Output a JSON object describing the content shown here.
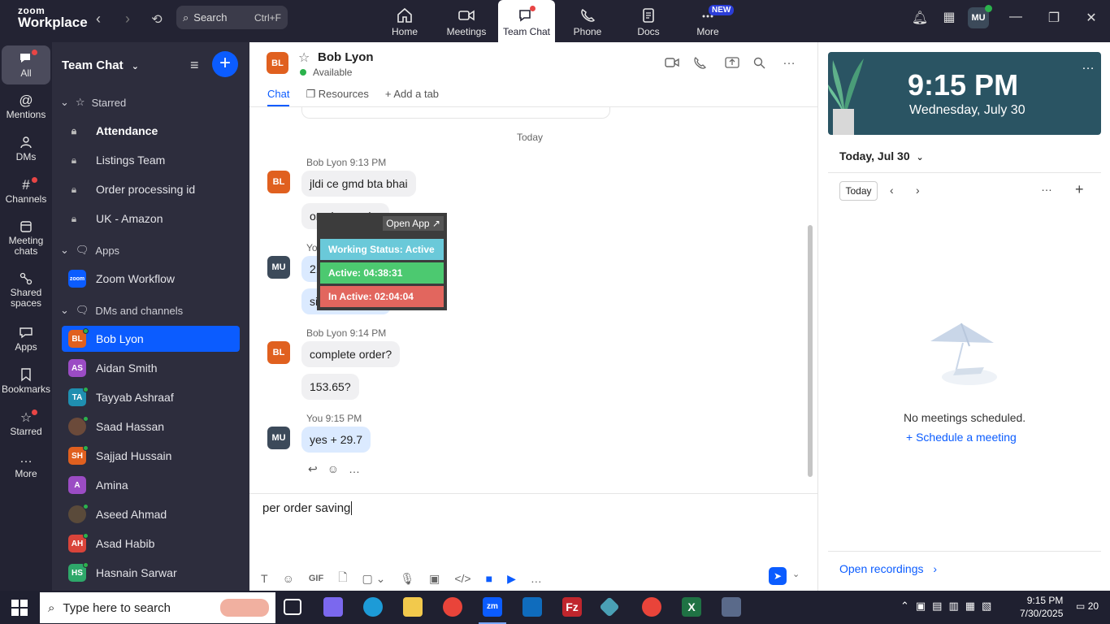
{
  "app": {
    "brand_top": "zoom",
    "brand_bottom": "Workplace"
  },
  "search": {
    "placeholder": "Search",
    "shortcut": "Ctrl+F"
  },
  "topnav": [
    {
      "label": "Home"
    },
    {
      "label": "Meetings"
    },
    {
      "label": "Team Chat"
    },
    {
      "label": "Phone"
    },
    {
      "label": "Docs"
    },
    {
      "label": "More"
    }
  ],
  "new_badge": "NEW",
  "user": {
    "initials": "MU"
  },
  "rail": [
    {
      "label": "All"
    },
    {
      "label": "Mentions"
    },
    {
      "label": "DMs"
    },
    {
      "label": "Channels"
    },
    {
      "label": "Meeting chats"
    },
    {
      "label": "Shared spaces"
    },
    {
      "label": "Apps"
    },
    {
      "label": "Bookmarks"
    },
    {
      "label": "Starred"
    },
    {
      "label": "More"
    }
  ],
  "sidebar": {
    "title": "Team Chat",
    "sections": {
      "starred": "Starred",
      "apps": "Apps",
      "dms": "DMs and channels"
    },
    "starred_items": [
      "Attendance",
      "Listings Team",
      "Order processing id",
      "UK - Amazon"
    ],
    "app_items": [
      "Zoom Workflow"
    ],
    "app_icon_text": "zoom",
    "contacts": [
      {
        "initials": "BL",
        "name": "Bob Lyon",
        "color": "#e0601f"
      },
      {
        "initials": "AS",
        "name": "Aidan Smith",
        "color": "#9b4cc4"
      },
      {
        "initials": "TA",
        "name": "Tayyab Ashraaf",
        "color": "#1f8fb0"
      },
      {
        "initials": "",
        "name": "Saad Hassan",
        "color": "#6b4a3a"
      },
      {
        "initials": "SH",
        "name": "Sajjad Hussain",
        "color": "#e0601f"
      },
      {
        "initials": "A",
        "name": "Amina",
        "color": "#9b4cc4"
      },
      {
        "initials": "",
        "name": "Aseed Ahmad",
        "color": "#5a4a3a"
      },
      {
        "initials": "AH",
        "name": "Asad Habib",
        "color": "#d9443a"
      },
      {
        "initials": "HS",
        "name": "Hasnain Sarwar",
        "color": "#2ea86a"
      }
    ]
  },
  "chat": {
    "contact_initials": "BL",
    "contact_name": "Bob Lyon",
    "status": "Available",
    "tabs": [
      "Chat",
      "Resources",
      "+ Add a tab"
    ],
    "day_separator": "Today",
    "messages": [
      {
        "initials": "BL",
        "meta": "Bob Lyon 9:13 PM",
        "bubbles": [
          "jldi ce gmd bta bhai",
          "on cisco order"
        ]
      },
      {
        "initials": "MU",
        "meta": "You",
        "bubbles": [
          "21.95",
          "single quantity"
        ]
      },
      {
        "initials": "BL",
        "meta": "Bob Lyon 9:14 PM",
        "bubbles": [
          "complete order?",
          "153.65?"
        ]
      },
      {
        "initials": "MU",
        "meta": "You 9:15 PM",
        "bubbles": [
          "yes + 29.7"
        ]
      }
    ],
    "compose_text": "per order saving",
    "toolbar": {
      "gif": "GIF"
    }
  },
  "overlay": {
    "open_app": "Open App ↗",
    "working_status": "Working Status: Active",
    "active": "Active: 04:38:31",
    "inactive": "In Active: 02:04:04"
  },
  "right": {
    "time": "9:15 PM",
    "date": "Wednesday, July 30",
    "cal_head": "Today, Jul 30",
    "today_btn": "Today",
    "empty": "No meetings scheduled.",
    "schedule": "Schedule a meeting",
    "recordings": "Open recordings"
  },
  "taskbar": {
    "search_placeholder": "Type here to search",
    "time": "9:15 PM",
    "date": "7/30/2025",
    "notif_count": "20"
  },
  "colors": {
    "accent": "#0b5cff",
    "dark": "#232333",
    "sidebar": "#2d2d3d"
  }
}
